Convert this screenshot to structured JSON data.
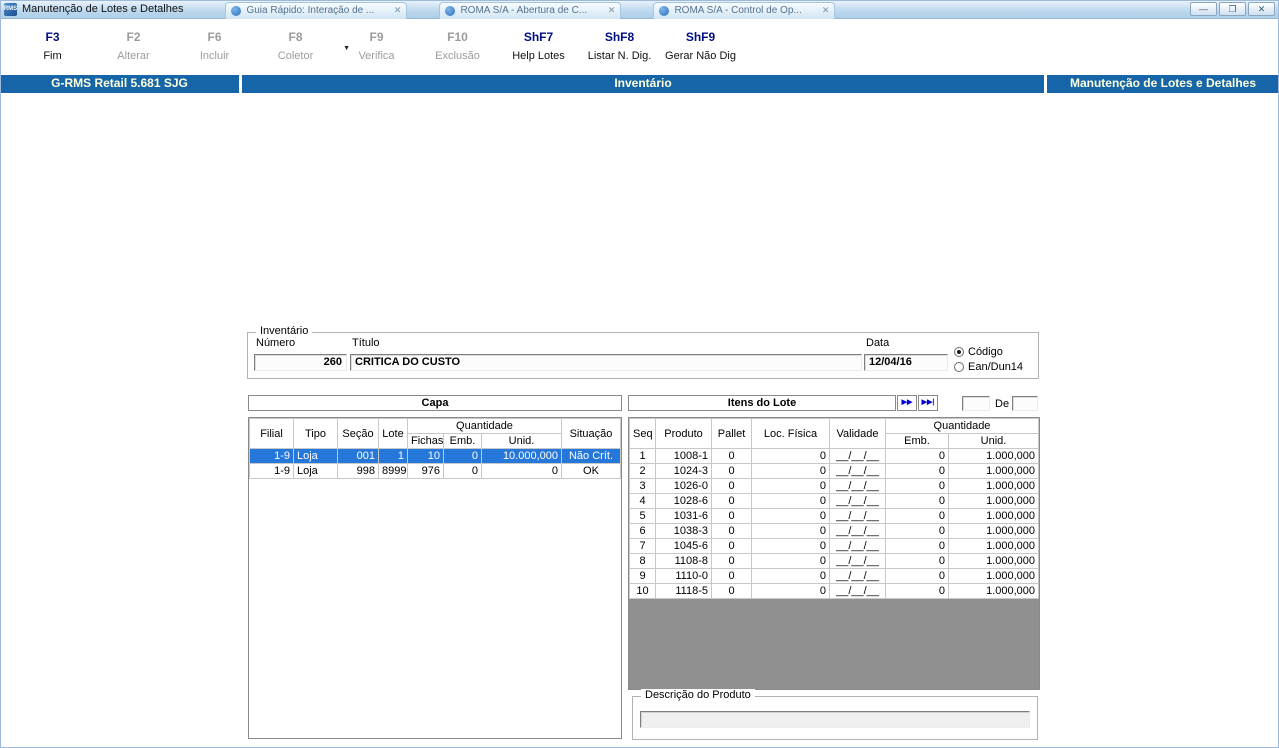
{
  "window": {
    "title": "Manutenção de Lotes e Detalhes",
    "app_icon_text": "RMS",
    "tabs": [
      {
        "label": "Guia Rápido: Interação de ..."
      },
      {
        "label": "ROMA S/A - Abertura de C..."
      },
      {
        "label": "ROMA S/A - Control de Op..."
      }
    ],
    "tab_close_glyph": "✕",
    "controls": {
      "minimize": "—",
      "restore": "❐",
      "close": "✕"
    }
  },
  "toolbar": {
    "dropdown_glyph": "▼",
    "items": [
      {
        "key": "F3",
        "label": "Fim",
        "active": true,
        "dropdown": false
      },
      {
        "key": "F2",
        "label": "Alterar",
        "active": false,
        "dropdown": false
      },
      {
        "key": "F6",
        "label": "Incluir",
        "active": false,
        "dropdown": false
      },
      {
        "key": "F8",
        "label": "Coletor",
        "active": false,
        "dropdown": true
      },
      {
        "key": "F9",
        "label": "Verifica",
        "active": false,
        "dropdown": false
      },
      {
        "key": "F10",
        "label": "Exclusão",
        "active": false,
        "dropdown": false
      },
      {
        "key": "ShF7",
        "label": "Help Lotes",
        "active": true,
        "dropdown": false
      },
      {
        "key": "ShF8",
        "label": "Listar N. Dig.",
        "active": true,
        "dropdown": false
      },
      {
        "key": "ShF9",
        "label": "Gerar Não Dig",
        "active": true,
        "dropdown": false
      }
    ]
  },
  "statusbar": {
    "left": "G-RMS Retail 5.681 SJG",
    "center": "Inventário",
    "right": "Manutenção de Lotes e Detalhes",
    "bg_color": "#1565a8",
    "text_color": "#ffffdf"
  },
  "inventario": {
    "group_label": "Inventário",
    "numero": {
      "label": "Número",
      "value": "260"
    },
    "titulo": {
      "label": "Título",
      "value": "CRITICA DO CUSTO"
    },
    "data": {
      "label": "Data",
      "value": "12/04/16"
    },
    "radios": {
      "codigo": "Código",
      "ean": "Ean/Dun14",
      "selected": "codigo"
    }
  },
  "capa": {
    "title": "Capa",
    "selection_color": "#2577d9",
    "headers": {
      "filial": "Filial",
      "tipo": "Tipo",
      "secao": "Seção",
      "lote": "Lote",
      "quantidade": "Quantidade",
      "fichas": "Fichas",
      "emb": "Emb.",
      "unid": "Unid.",
      "situacao": "Situação"
    },
    "rows": [
      {
        "filial": "1-9",
        "tipo": "Loja",
        "secao": "001",
        "lote": "1",
        "fichas": "10",
        "emb": "0",
        "unid": "10.000,000",
        "situacao": "Não Crít.",
        "selected": true
      },
      {
        "filial": "1-9",
        "tipo": "Loja",
        "secao": "998",
        "lote": "8999",
        "fichas": "976",
        "emb": "0",
        "unid": "0",
        "situacao": "OK",
        "selected": false
      }
    ]
  },
  "itens": {
    "title": "Itens do Lote",
    "nav": {
      "next_glyph": "▶▶",
      "last_glyph": "▶▶|"
    },
    "range": {
      "label": "De",
      "from_value": "",
      "to_value": ""
    },
    "headers": {
      "seq": "Seq",
      "produto": "Produto",
      "pallet": "Pallet",
      "loc": "Loc. Física",
      "validade": "Validade",
      "quantidade": "Quantidade",
      "emb": "Emb.",
      "unid": "Unid."
    },
    "rows": [
      {
        "seq": "1",
        "produto": "1008-1",
        "pallet": "0",
        "loc": "0",
        "validade": "__/__/__",
        "emb": "0",
        "unid": "1.000,000"
      },
      {
        "seq": "2",
        "produto": "1024-3",
        "pallet": "0",
        "loc": "0",
        "validade": "__/__/__",
        "emb": "0",
        "unid": "1.000,000"
      },
      {
        "seq": "3",
        "produto": "1026-0",
        "pallet": "0",
        "loc": "0",
        "validade": "__/__/__",
        "emb": "0",
        "unid": "1.000,000"
      },
      {
        "seq": "4",
        "produto": "1028-6",
        "pallet": "0",
        "loc": "0",
        "validade": "__/__/__",
        "emb": "0",
        "unid": "1.000,000"
      },
      {
        "seq": "5",
        "produto": "1031-6",
        "pallet": "0",
        "loc": "0",
        "validade": "__/__/__",
        "emb": "0",
        "unid": "1.000,000"
      },
      {
        "seq": "6",
        "produto": "1038-3",
        "pallet": "0",
        "loc": "0",
        "validade": "__/__/__",
        "emb": "0",
        "unid": "1.000,000"
      },
      {
        "seq": "7",
        "produto": "1045-6",
        "pallet": "0",
        "loc": "0",
        "validade": "__/__/__",
        "emb": "0",
        "unid": "1.000,000"
      },
      {
        "seq": "8",
        "produto": "1108-8",
        "pallet": "0",
        "loc": "0",
        "validade": "__/__/__",
        "emb": "0",
        "unid": "1.000,000"
      },
      {
        "seq": "9",
        "produto": "1110-0",
        "pallet": "0",
        "loc": "0",
        "validade": "__/__/__",
        "emb": "0",
        "unid": "1.000,000"
      },
      {
        "seq": "10",
        "produto": "1118-5",
        "pallet": "0",
        "loc": "0",
        "validade": "__/__/__",
        "emb": "0",
        "unid": "1.000,000"
      }
    ]
  },
  "descricao": {
    "group_label": "Descrição do Produto",
    "value": ""
  }
}
